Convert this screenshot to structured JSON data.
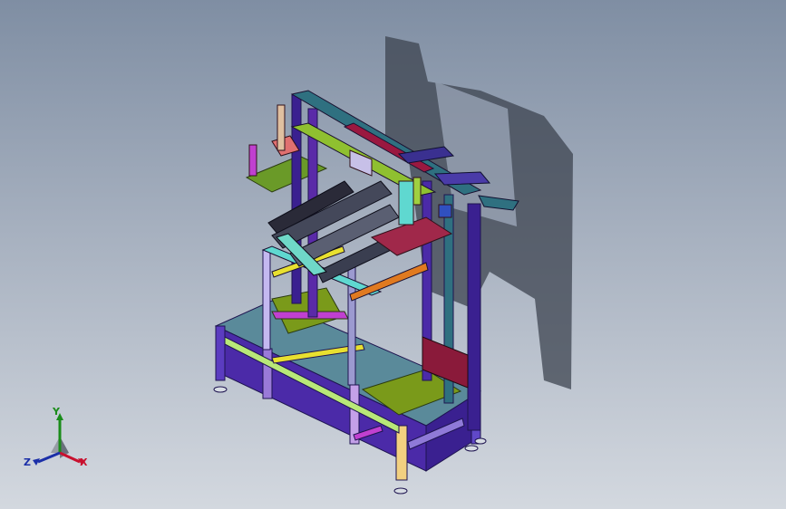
{
  "viewport": {
    "background_top": "#7f8ea3",
    "background_bottom": "#d3d8df"
  },
  "model": {
    "icon": "machine-frame-3d-model",
    "colors": {
      "frame_purple": "#4b2aa8",
      "plate_green": "#7a9a1a",
      "rail_cyan": "#5fd8d0",
      "accent_pink": "#e07070",
      "beam_crimson": "#9a1840",
      "beam_magenta": "#c040d0",
      "beam_orange": "#e07a20",
      "beam_yellow": "#e8e030",
      "plate_maroon": "#a0284a",
      "teal_bracket": "#2f7080",
      "shadow": "#3d4450"
    }
  },
  "triad": {
    "icon": "coordinate-axes-triad-icon",
    "x_label": "X",
    "y_label": "Y",
    "z_label": "Z",
    "x_color": "#c8102e",
    "y_color": "#1a8c1a",
    "z_color": "#1b2fa8"
  }
}
